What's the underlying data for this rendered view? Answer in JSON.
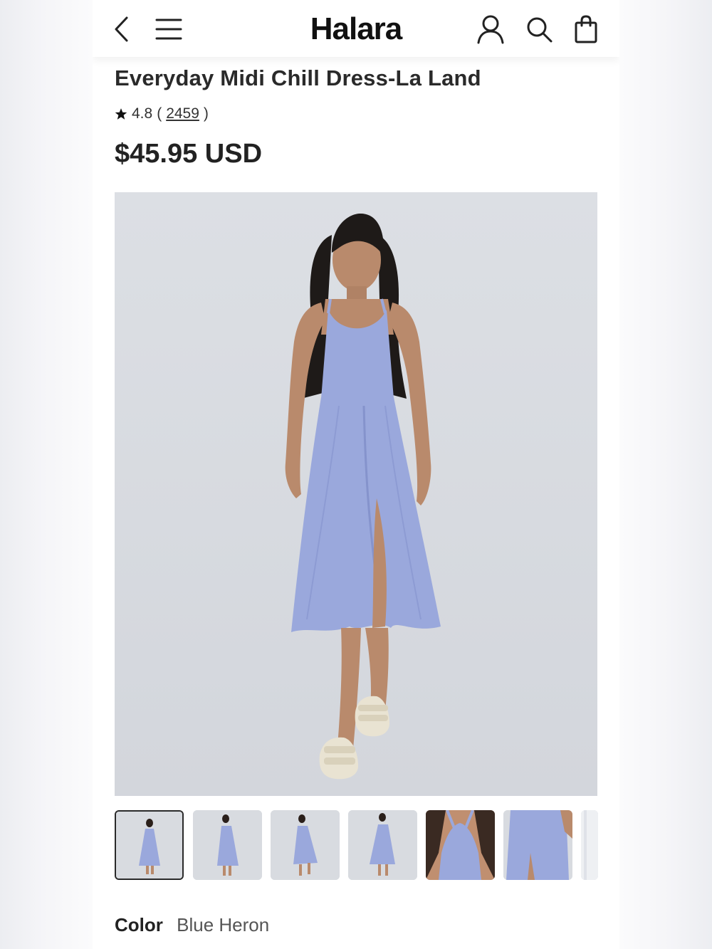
{
  "header": {
    "logo": "Halara"
  },
  "product": {
    "title": "Everyday Midi Chill Dress-La Land",
    "rating": "4.8",
    "rating_open": "(",
    "review_count": "2459",
    "rating_close": ")",
    "price": "$45.95 USD",
    "color_label": "Color",
    "color_value": "Blue Heron"
  },
  "colors": {
    "dress": "#9aa8dc",
    "dress_dark": "#8593cc",
    "skin": "#b98a6c",
    "hair": "#1e1a18",
    "sandal": "#e9e3d2",
    "background": "#dcdfe4"
  },
  "icons": [
    "back-icon",
    "menu-icon",
    "account-icon",
    "search-icon",
    "bag-icon",
    "star-icon"
  ]
}
